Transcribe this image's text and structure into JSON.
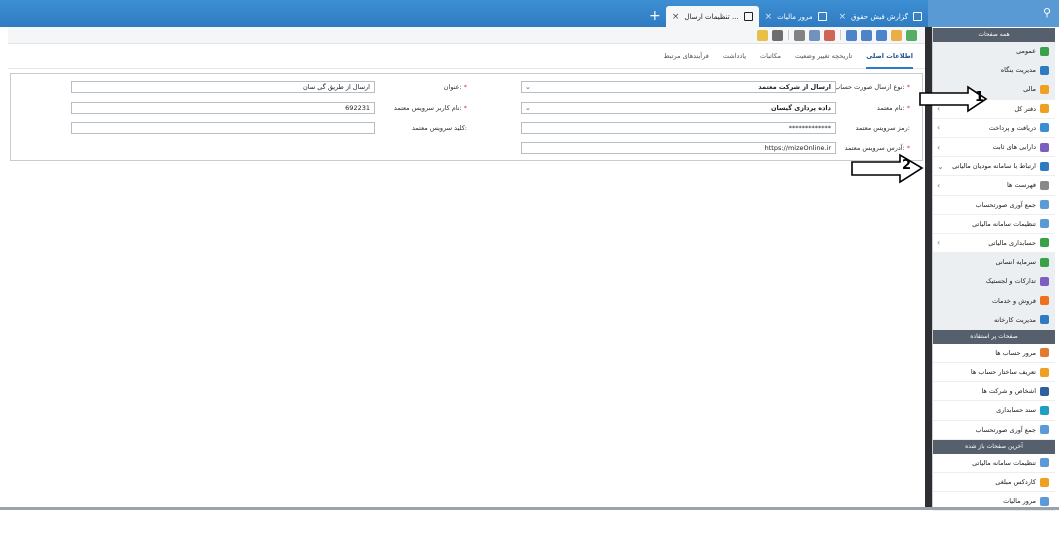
{
  "tabs": [
    {
      "label": "گزارش فیش حقوق",
      "active": false
    },
    {
      "label": "مرور مالیات",
      "active": false
    },
    {
      "label": "تنظیمات ارسال ...",
      "active": true
    }
  ],
  "toolbar_icons": [
    "add-icon",
    "folder-icon",
    "save-icon",
    "save-as-icon",
    "delete-icon",
    "copy-icon",
    "paste-icon",
    "stamp-icon",
    "print-icon",
    "alert-icon"
  ],
  "subtabs": [
    {
      "label": "اطلاعات اصلی",
      "active": true
    },
    {
      "label": "تاریخچه تغییر وضعیت",
      "active": false
    },
    {
      "label": "مکاتبات",
      "active": false
    },
    {
      "label": "یادداشت",
      "active": false
    },
    {
      "label": "فرآیندهای مرتبط",
      "active": false
    }
  ],
  "form": {
    "send_type_label": "نوع ارسال صورت حساب:",
    "send_type_value": "ارسال از شرکت معتمد",
    "title_label": "عنوان:",
    "title_value": "ارسال از طریق گی سان",
    "trusted_name_label": "نام معتمد:",
    "trusted_name_value": "داده پردازی گیسان",
    "username_label": "نام کاربر سرویس معتمد:",
    "username_value": "692231",
    "password_label": "رمز سرویس معتمد:",
    "password_value": "*************",
    "key_label": "کلید سرویس معتمد:",
    "key_value": "",
    "address_label": "آدرس سرویس معتمد:",
    "address_value": "https://mizeOnline.ir",
    "required_mark": "*"
  },
  "sidebar": {
    "header_all": "همه صفحات",
    "items": [
      {
        "label": "عمومی",
        "color": "#3aa04a"
      },
      {
        "label": "مدیریت بنگاه",
        "color": "#2f7bc1"
      },
      {
        "label": "مالی",
        "color": "#f0a020"
      }
    ],
    "finance_children": [
      {
        "label": "دفتر کل",
        "color": "#f0a020",
        "chev": "›"
      },
      {
        "label": "دریافت و پرداخت",
        "color": "#3a8fd0",
        "chev": "›"
      },
      {
        "label": "دارایی های ثابت",
        "color": "#7b5fc0",
        "chev": "›"
      },
      {
        "label": "ارتباط با سامانه مودیان مالیاتی",
        "color": "#2f7bc1",
        "chev": "⌄"
      },
      {
        "label": "فهرست ها",
        "color": "#888",
        "chev": "›"
      },
      {
        "label": "جمع آوری صورتحساب",
        "color": "#5c9ad6",
        "chev": ""
      },
      {
        "label": "تنظیمات سامانه مالیاتی",
        "color": "#5c9ad6",
        "chev": ""
      },
      {
        "label": "حسابداری مالیاتی",
        "color": "#3aa04a",
        "chev": "›"
      }
    ],
    "more_items": [
      {
        "label": "سرمایه انسانی",
        "color": "#3aa04a"
      },
      {
        "label": "تدارکات و لجستیک",
        "color": "#7b5fc0"
      },
      {
        "label": "فروش و خدمات",
        "color": "#f07020"
      },
      {
        "label": "مدیریت کارخانه",
        "color": "#2f7bc1"
      }
    ],
    "header_frequent": "صفحات پر استفاده",
    "frequent": [
      {
        "label": "مرور حساب ها",
        "color": "#e07b30"
      },
      {
        "label": "تعریف ساختار حساب ها",
        "color": "#f0a020"
      },
      {
        "label": "اشخاص و شرکت ها",
        "color": "#2f5fa0"
      },
      {
        "label": "سند حسابداری",
        "color": "#20a0c0"
      },
      {
        "label": "جمع آوری صورتحساب",
        "color": "#5c9ad6"
      }
    ],
    "header_recent": "آخرین صفحات باز شده",
    "recent": [
      {
        "label": "تنظیمات سامانه مالیاتی",
        "color": "#5c9ad6"
      },
      {
        "label": "کاردکس مبلغی",
        "color": "#f0a020"
      },
      {
        "label": "مرور مالیات",
        "color": "#5c9ad6"
      }
    ]
  },
  "annotations": [
    {
      "number": "1"
    },
    {
      "number": "2"
    }
  ]
}
